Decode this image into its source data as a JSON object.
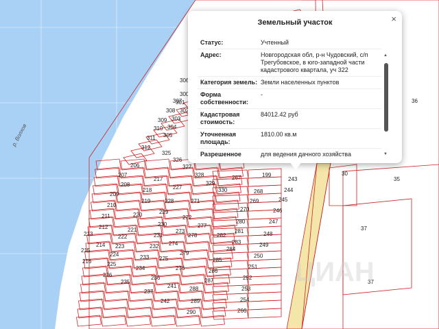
{
  "map": {
    "river_label": "р. Волхов",
    "watermark": "ЦИАН",
    "colors": {
      "water": "#a9d0f5",
      "plot_line": "#cc2222",
      "land": "#ffffff",
      "road": "#f4e6a8"
    },
    "plot_labels": [
      "300",
      "301",
      "302",
      "303",
      "304",
      "305",
      "306",
      "307",
      "308",
      "309",
      "310",
      "311",
      "312",
      "206",
      "207",
      "208",
      "209",
      "210",
      "211",
      "212",
      "213",
      "214",
      "215",
      "216",
      "217",
      "218",
      "219",
      "220",
      "221",
      "222",
      "223",
      "224",
      "225",
      "226",
      "227",
      "228",
      "229",
      "230",
      "231",
      "232",
      "233",
      "234",
      "235",
      "236",
      "237",
      "241",
      "242",
      "243",
      "244",
      "245",
      "246",
      "247",
      "248",
      "249",
      "250",
      "251",
      "252",
      "253",
      "254",
      "266",
      "267",
      "268",
      "269",
      "270",
      "271",
      "272",
      "273",
      "274",
      "275",
      "276",
      "277",
      "278",
      "279",
      "280",
      "281",
      "282",
      "283",
      "284",
      "285",
      "286",
      "287",
      "288",
      "289",
      "290",
      "325",
      "326",
      "327",
      "328",
      "329",
      "330",
      "199",
      "30",
      "35",
      "36",
      "37",
      "37"
    ]
  },
  "popup": {
    "title": "Земельный участок",
    "close": "×",
    "rows": [
      {
        "key": "Статус:",
        "value": "Учтенный"
      },
      {
        "key": "Адрес:",
        "value": "Новгородская обл, р-н Чудовский, с/п Трегубовское, в юго-западной части кадастрового квартала, уч 322"
      },
      {
        "key": "Категория земель:",
        "value": "Земли населенных пунктов"
      },
      {
        "key": "Форма собственности:",
        "value": "-"
      },
      {
        "key": "Кадастровая стоимость:",
        "value": "84012.42 руб"
      },
      {
        "key": "Уточненная площадь:",
        "value": "1810.00 кв.м"
      },
      {
        "key": "Разрешенное использование:",
        "value": "для ведения дачного хозяйства"
      }
    ]
  }
}
